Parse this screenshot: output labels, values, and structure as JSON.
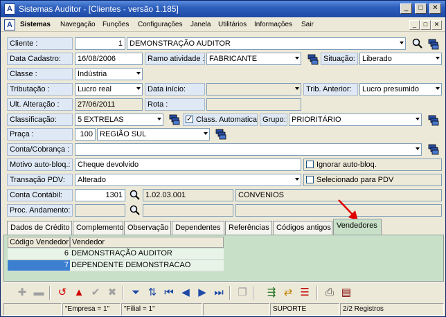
{
  "window": {
    "title": "Sistemas Auditor - [Clientes - versão 1.185]",
    "app_icon_letter": "A",
    "btn_min": "_",
    "btn_max": "□",
    "btn_close": "✕"
  },
  "menu": {
    "brand": "Sistemas",
    "items": [
      "Navegação",
      "Funções",
      "Configurações",
      "Janela",
      "Utilitários",
      "Informações",
      "Sair"
    ]
  },
  "form": {
    "cliente": {
      "label": "Cliente :",
      "code": "1",
      "name": "DEMONSTRAÇÃO AUDITOR"
    },
    "data_cadastro": {
      "label": "Data Cadastro:",
      "value": "16/08/2006"
    },
    "ramo": {
      "label": "Ramo atividade :",
      "value": "FABRICANTE"
    },
    "situacao": {
      "label": "Situação:",
      "value": "Liberado"
    },
    "classe": {
      "label": "Classe :",
      "value": "Indústria"
    },
    "tributacao": {
      "label": "Tributação :",
      "value": "Lucro real"
    },
    "data_inicio": {
      "label": "Data início:",
      "value": ""
    },
    "trib_anterior": {
      "label": "Trib. Anterior:",
      "value": "Lucro presumido"
    },
    "ult_alteracao": {
      "label": "Ult. Alteração :",
      "value": "27/06/2011"
    },
    "rota": {
      "label": "Rota :",
      "value": ""
    },
    "classificacao": {
      "label": "Classificação:",
      "value": "5 EXTRELAS"
    },
    "class_automatica": {
      "label": "Class. Automatica",
      "checked": true
    },
    "grupo": {
      "label": "Grupo:",
      "value": "PRIORITÁRIO"
    },
    "praca": {
      "label": "Praça :",
      "code": "100",
      "value": "REGIÃO SUL"
    },
    "conta_cobranca": {
      "label": "Conta/Cobrança :",
      "value": ""
    },
    "motivo": {
      "label": "Motivo auto-bloq.:",
      "value": "Cheque devolvido"
    },
    "ignorar": {
      "label": "Ignorar auto-bloq.",
      "checked": false
    },
    "transacao": {
      "label": "Transação PDV:",
      "value": "Alterado"
    },
    "selecionado_pdv": {
      "label": "Selecionado para PDV",
      "checked": false
    },
    "conta_contabil": {
      "label": "Conta Contábil:",
      "code": "1301",
      "account": "1.02.03.001",
      "desc": "CONVENIOS"
    },
    "proc_andamento": {
      "label": "Proc. Andamento:",
      "value": ""
    }
  },
  "tabs": [
    "Dados de Crédito",
    "Complemento",
    "Observação",
    "Dependentes",
    "Referências",
    "Códigos antigos",
    "Vendedores"
  ],
  "active_tab": "Vendedores",
  "grid": {
    "headers": [
      "Código Vendedor",
      "Vendedor"
    ],
    "rows": [
      {
        "code": "6",
        "name": "DEMONSTRAÇÃO AUDITOR"
      },
      {
        "code": "7",
        "name": "DEPENDENTE DEMONSTRACAO"
      }
    ]
  },
  "status": {
    "empresa": "\"Empresa = 1\"",
    "filial": "\"Filial = 1\"",
    "user": "SUPORTE",
    "registros": "2/2 Registros"
  },
  "colors": {
    "accent": "#2e5fbd",
    "panel": "#c8e0c8",
    "selected_row": "#3c7fd0",
    "arrow": "#e00000"
  }
}
